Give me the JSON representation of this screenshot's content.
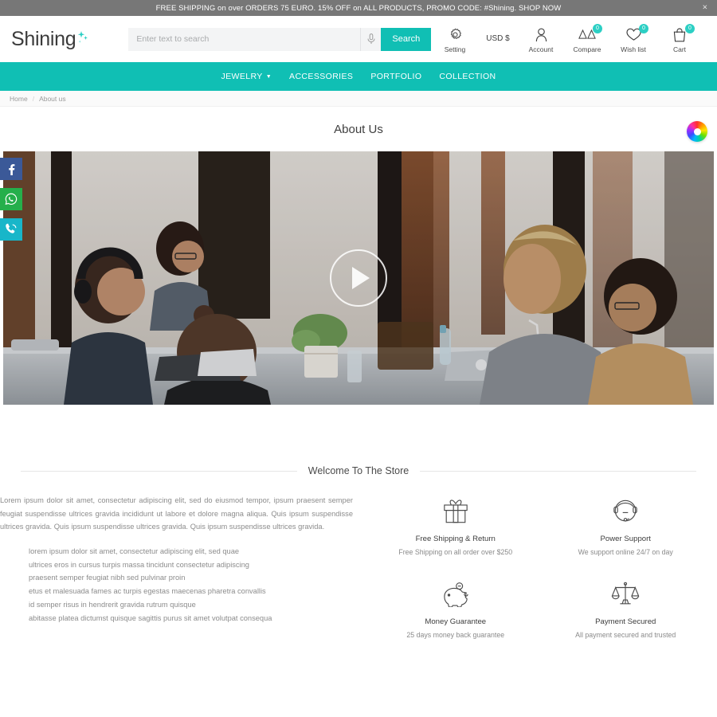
{
  "promo": {
    "text": "FREE SHIPPING on over ORDERS 75 EURO. 15% OFF on ALL PRODUCTS, PROMO CODE: #Shining. SHOP NOW",
    "close_label": "×"
  },
  "header": {
    "logo": "Shining",
    "search": {
      "placeholder": "Enter text to search",
      "value": "",
      "button_label": "Search"
    },
    "tools": [
      {
        "label": "Setting",
        "icon": "gear-icon",
        "badge": null
      },
      {
        "label": "USD $",
        "icon": "currency-icon",
        "badge": null
      },
      {
        "label": "Account",
        "icon": "user-icon",
        "badge": null
      },
      {
        "label": "Compare",
        "icon": "compare-scales-icon",
        "badge": "0"
      },
      {
        "label": "Wish list",
        "icon": "heart-icon",
        "badge": "0"
      },
      {
        "label": "Cart",
        "icon": "bag-icon",
        "badge": "0"
      }
    ]
  },
  "nav": {
    "items": [
      {
        "label": "JEWELRY",
        "has_dropdown": true
      },
      {
        "label": "ACCESSORIES",
        "has_dropdown": false
      },
      {
        "label": "PORTFOLIO",
        "has_dropdown": false
      },
      {
        "label": "COLLECTION",
        "has_dropdown": false
      }
    ]
  },
  "breadcrumb": {
    "home": "Home",
    "separator": "/",
    "current": "About us"
  },
  "page": {
    "title": "About Us"
  },
  "social_rail": [
    {
      "name": "facebook",
      "color": "#3b5998"
    },
    {
      "name": "whatsapp",
      "color": "#25af4b"
    },
    {
      "name": "phone",
      "color": "#18b6c9"
    }
  ],
  "hero": {
    "play_label": "Play video"
  },
  "welcome": {
    "heading": "Welcome To The Store"
  },
  "about": {
    "lead": "Lorem ipsum dolor sit amet, consectetur adipiscing elit, sed do eiusmod tempor, ipsum praesent semper feugiat suspendisse ultrices gravida incididunt ut labore et dolore magna aliqua. Quis ipsum suspendisse ultrices gravida. Quis ipsum suspendisse ultrices gravida. Quis ipsum suspendisse ultrices gravida.",
    "bullets": [
      "lorem ipsum dolor sit amet, consectetur adipiscing elit, sed quae",
      "ultrices eros in cursus turpis massa tincidunt consectetur adipiscing",
      "praesent semper feugiat nibh sed pulvinar proin",
      "etus et malesuada fames ac turpis egestas maecenas pharetra convallis",
      "id semper risus in hendrerit gravida rutrum quisque",
      "abitasse platea dictumst quisque sagittis purus sit amet volutpat consequa"
    ]
  },
  "features": [
    {
      "icon": "gift-icon",
      "title": "Free Shipping & Return",
      "subtitle": "Free Shipping on all order over $250"
    },
    {
      "icon": "headset-support-icon",
      "title": "Power Support",
      "subtitle": "We support online 24/7 on day"
    },
    {
      "icon": "piggy-bank-icon",
      "title": "Money Guarantee",
      "subtitle": "25 days money back guarantee"
    },
    {
      "icon": "scales-icon",
      "title": "Payment Secured",
      "subtitle": "All payment secured and trusted"
    }
  ],
  "theme": {
    "accent": "#10bfb4",
    "promo_bg": "#777777",
    "badge": "#2ccfc4"
  }
}
